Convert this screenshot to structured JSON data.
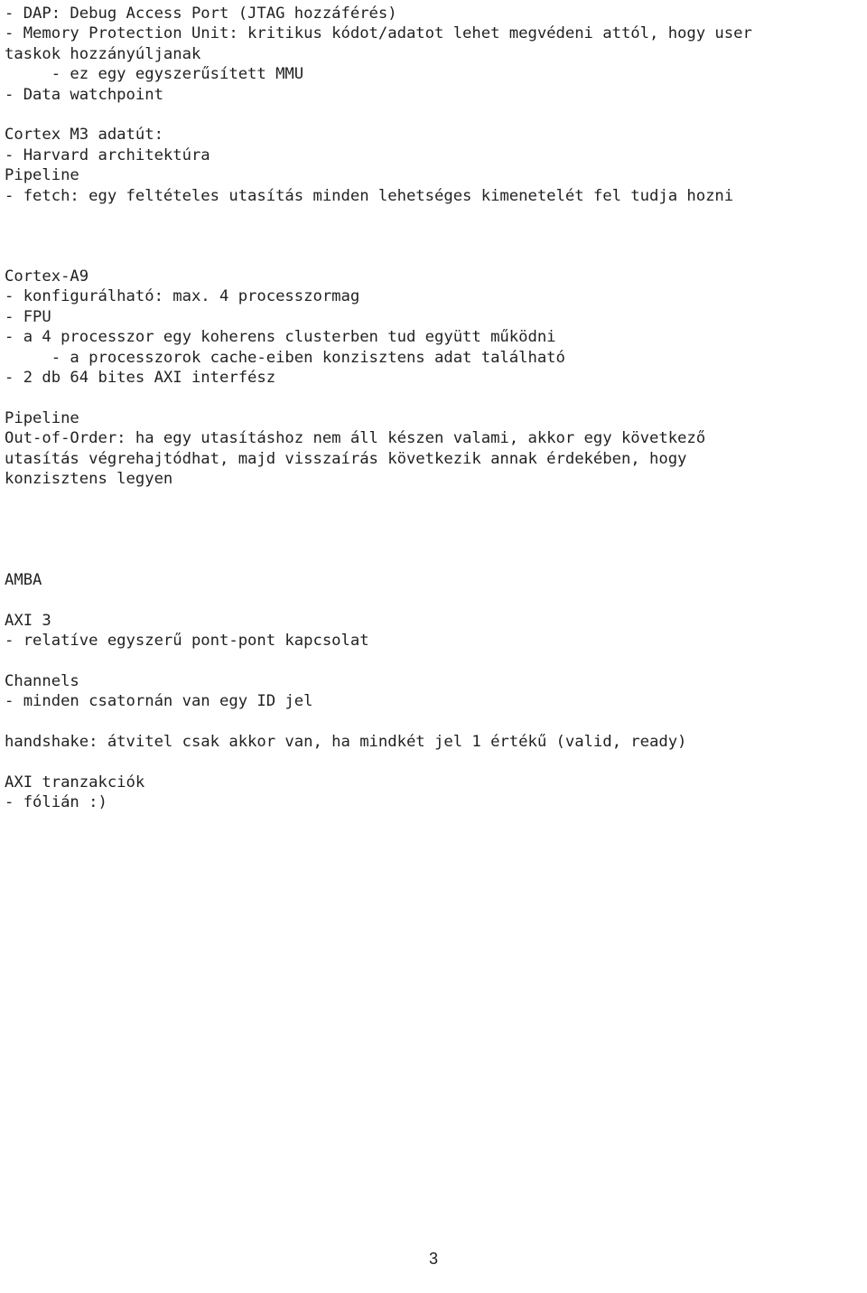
{
  "document": {
    "page_number": "3",
    "lines": [
      "- DAP: Debug Access Port (JTAG hozzáférés)",
      "- Memory Protection Unit: kritikus kódot/adatot lehet megvédeni attól, hogy user",
      "taskok hozzányúljanak",
      "     - ez egy egyszerűsített MMU",
      "- Data watchpoint",
      "",
      "Cortex M3 adatút:",
      "- Harvard architektúra",
      "Pipeline",
      "- fetch: egy feltételes utasítás minden lehetséges kimenetelét fel tudja hozni",
      "",
      "",
      "",
      "Cortex-A9",
      "- konfigurálható: max. 4 processzormag",
      "- FPU",
      "- a 4 processzor egy koherens clusterben tud együtt működni",
      "     - a processzorok cache-eiben konzisztens adat található",
      "- 2 db 64 bites AXI interfész",
      "",
      "Pipeline",
      "Out-of-Order: ha egy utasításhoz nem áll készen valami, akkor egy következő",
      "utasítás végrehajtódhat, majd visszaírás következik annak érdekében, hogy",
      "konzisztens legyen",
      "",
      "",
      "",
      "",
      "AMBA",
      "",
      "AXI 3",
      "- relatíve egyszerű pont-pont kapcsolat",
      "",
      "Channels",
      "- minden csatornán van egy ID jel",
      "",
      "handshake: átvitel csak akkor van, ha mindkét jel 1 értékű (valid, ready)",
      "",
      "AXI tranzakciók",
      "- fólián :)"
    ]
  }
}
